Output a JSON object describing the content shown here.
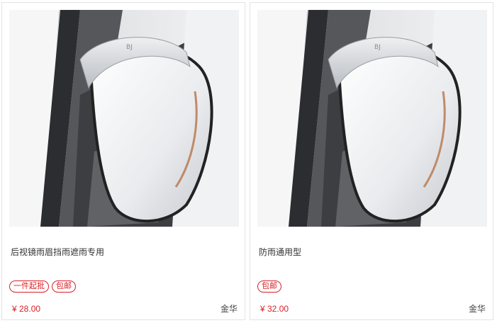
{
  "products": [
    {
      "title": "后视镜雨眉挡雨遮雨专用",
      "image_alt": "white car side mirror with rain visor",
      "tags": [
        "一件起批",
        "包邮"
      ],
      "price": "¥ 28.00",
      "location": "金华"
    },
    {
      "title": "防雨通用型",
      "image_alt": "white car side mirror with rain visor",
      "tags": [
        "包邮"
      ],
      "price": "¥ 32.00",
      "location": "金华"
    }
  ],
  "colors": {
    "accent": "#d91f26",
    "border": "#e3e3e3",
    "title_text": "#333333"
  }
}
